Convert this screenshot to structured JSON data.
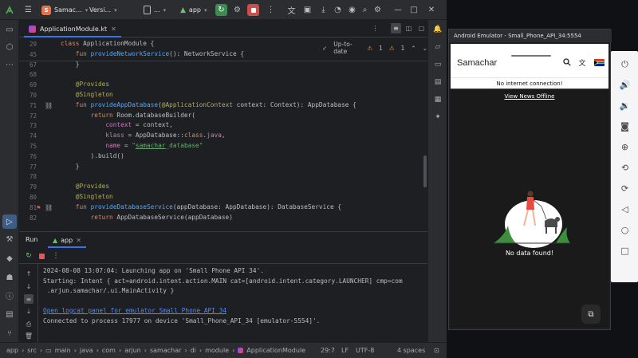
{
  "ide": {
    "titlebar": {
      "project_badge": "S",
      "project_name": "Samac...",
      "vcs_label": "Versi...",
      "device_label": "...",
      "run_config": "app",
      "window_buttons": [
        "minimize-icon",
        "maximize-icon",
        "close-icon"
      ]
    },
    "tab": {
      "filename": "ApplicationModule.kt"
    },
    "editor": {
      "vcs_status": "Up-to-date",
      "warning_count": "1",
      "weak_warning_count": "1",
      "lines": [
        {
          "n": "29",
          "tokens": [
            [
              "kw",
              "class "
            ],
            [
              "cls",
              "ApplicationModule "
            ],
            [
              "ty",
              "{"
            ]
          ]
        },
        {
          "n": "45",
          "tokens": [
            [
              "ty",
              "    "
            ],
            [
              "kw",
              "fun "
            ],
            [
              "fn",
              "provideNetworkService"
            ],
            [
              "ty",
              "(): NetworkService {"
            ]
          ]
        },
        {
          "n": "67",
          "tokens": [
            [
              "ty",
              "    }"
            ]
          ]
        },
        {
          "n": "68",
          "tokens": [
            [
              "ty",
              ""
            ]
          ]
        },
        {
          "n": "69",
          "tokens": [
            [
              "an",
              "    @Provides"
            ]
          ]
        },
        {
          "n": "70",
          "tokens": [
            [
              "an",
              "    @Singleton"
            ]
          ]
        },
        {
          "n": "71",
          "tokens": [
            [
              "ty",
              "    "
            ],
            [
              "kw",
              "fun "
            ],
            [
              "fn",
              "provideAppDatabase"
            ],
            [
              "ty",
              "("
            ],
            [
              "an",
              "@ApplicationContext "
            ],
            [
              "ty",
              "context: Context): AppDatabase {"
            ]
          ]
        },
        {
          "n": "72",
          "tokens": [
            [
              "ty",
              "        "
            ],
            [
              "kw",
              "return "
            ],
            [
              "ty",
              "Room.databaseBuilder("
            ]
          ]
        },
        {
          "n": "73",
          "tokens": [
            [
              "ty",
              "            "
            ],
            [
              "par",
              "context "
            ],
            [
              "ty",
              "= context,"
            ]
          ]
        },
        {
          "n": "74",
          "tokens": [
            [
              "ty",
              "            "
            ],
            [
              "par",
              "klass "
            ],
            [
              "ty",
              "= AppDatabase::"
            ],
            [
              "kw",
              "class"
            ],
            [
              "ty",
              "."
            ],
            [
              "par",
              "java"
            ],
            [
              "ty",
              ","
            ]
          ]
        },
        {
          "n": "75",
          "tokens": [
            [
              "ty",
              "            "
            ],
            [
              "par",
              "name "
            ],
            [
              "ty",
              "= "
            ],
            [
              "str",
              "\""
            ],
            [
              "str und",
              "samachar"
            ],
            [
              "str",
              "_database\""
            ]
          ]
        },
        {
          "n": "76",
          "tokens": [
            [
              "ty",
              "        ).build()"
            ]
          ]
        },
        {
          "n": "77",
          "tokens": [
            [
              "ty",
              "    }"
            ]
          ]
        },
        {
          "n": "78",
          "tokens": [
            [
              "ty",
              ""
            ]
          ]
        },
        {
          "n": "79",
          "tokens": [
            [
              "an",
              "    @Provides"
            ]
          ]
        },
        {
          "n": "80",
          "tokens": [
            [
              "an",
              "    @Singleton"
            ]
          ]
        },
        {
          "n": "81",
          "tokens": [
            [
              "ty",
              "    "
            ],
            [
              "kw",
              "fun "
            ],
            [
              "fn",
              "provideDatabaseService"
            ],
            [
              "ty",
              "(appDatabase: AppDatabase): DatabaseService {"
            ]
          ]
        },
        {
          "n": "82",
          "tokens": [
            [
              "ty",
              "        "
            ],
            [
              "kw",
              "return "
            ],
            [
              "ty",
              "AppDatabaseService(appDatabase)"
            ]
          ]
        }
      ]
    },
    "run_panel": {
      "title": "Run",
      "tab": "app",
      "console": [
        {
          "text": "2024-08-08 13:07:04: Launching app on 'Small Phone API 34'.",
          "link": false
        },
        {
          "text": "Starting: Intent { act=android.intent.action.MAIN cat=[android.intent.category.LAUNCHER] cmp=com",
          "link": false
        },
        {
          "text": " .arjun.samachar/.ui.MainActivity }",
          "link": false
        },
        {
          "text": "",
          "link": false
        },
        {
          "text": "Open logcat panel for emulator Small Phone API 34",
          "link": true
        },
        {
          "text": "Connected to process 17977 on device 'Small_Phone_API_34 [emulator-5554]'.",
          "link": false
        }
      ]
    },
    "statusbar": {
      "breadcrumbs": [
        "app",
        "src",
        "main",
        "java",
        "com",
        "arjun",
        "samachar",
        "di",
        "module",
        "ApplicationModule"
      ],
      "position": "29:7",
      "line_sep": "LF",
      "encoding": "UTF-8",
      "indent": "4 spaces"
    }
  },
  "emulator": {
    "window_title": "Android Emulator - Small_Phone_API_34:5554",
    "app": {
      "title": "Samachar",
      "banner": "No internet connection!",
      "offline_link": "View News Offline",
      "empty_message": "No data found!"
    },
    "side_controls": [
      "power-icon",
      "volume-up-icon",
      "volume-down-icon",
      "camera-icon",
      "zoom-icon",
      "rotate-left-icon",
      "rotate-right-icon",
      "back-icon",
      "home-icon",
      "overview-icon"
    ]
  },
  "colors": {
    "accent": "#3574f0",
    "run_green": "#3b8c4e",
    "stop_red": "#c94f4f",
    "keyword": "#cf8e6d",
    "annotation": "#b3ae60",
    "function": "#56a8f5",
    "string": "#6aab73"
  }
}
